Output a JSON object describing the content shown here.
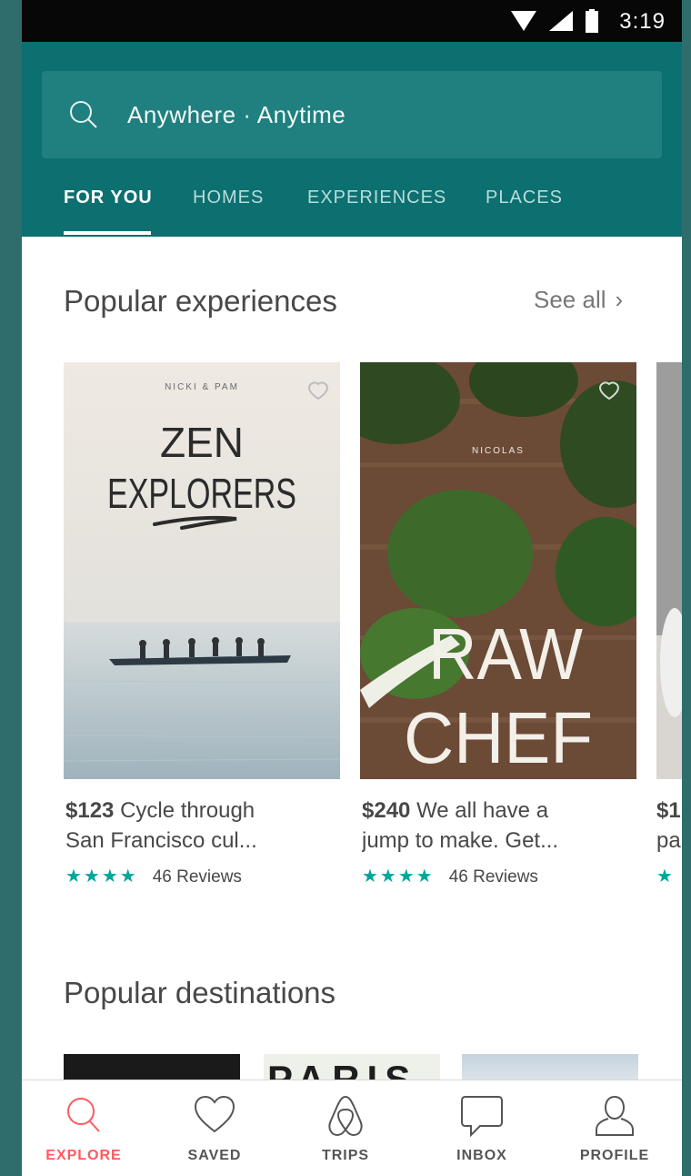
{
  "status_bar": {
    "time": "3:19"
  },
  "search": {
    "placeholder": "Anywhere · Anytime",
    "icon": "search-icon"
  },
  "tabs": [
    {
      "label": "FOR YOU",
      "active": true
    },
    {
      "label": "HOMES",
      "active": false
    },
    {
      "label": "EXPERIENCES",
      "active": false
    },
    {
      "label": "PLACES",
      "active": false
    }
  ],
  "experiences": {
    "title": "Popular experiences",
    "see_all": "See all",
    "cards": [
      {
        "host": "NICKI & PAM",
        "poster_line1": "ZEN",
        "poster_line2": "EXPLORERS",
        "price": "$123",
        "desc_line1": "Cycle through",
        "desc_line2": "San Francisco cul...",
        "stars": "★★★★",
        "reviews": "46 Reviews"
      },
      {
        "host": "NICOLAS",
        "poster_line1": "RAW",
        "poster_line2": "CHEF",
        "price": "$240",
        "desc_line1": "We all have a",
        "desc_line2": "jump to make. Get...",
        "stars": "★★★★",
        "reviews": "46 Reviews"
      },
      {
        "price": "$1",
        "desc_line2": "pa",
        "stars": "★"
      }
    ]
  },
  "destinations": {
    "title": "Popular destinations",
    "cards": [
      {
        "label": ""
      },
      {
        "label": "PARIS"
      },
      {
        "label": ""
      }
    ]
  },
  "bottom_nav": [
    {
      "label": "EXPLORE",
      "icon": "search-icon",
      "active": true
    },
    {
      "label": "SAVED",
      "icon": "heart-icon",
      "active": false
    },
    {
      "label": "TRIPS",
      "icon": "airbnb-logo-icon",
      "active": false
    },
    {
      "label": "INBOX",
      "icon": "message-icon",
      "active": false
    },
    {
      "label": "PROFILE",
      "icon": "user-icon",
      "active": false
    }
  ],
  "colors": {
    "header": "#0c6f70",
    "accent": "#ff5a5f",
    "stars": "#00a699"
  }
}
